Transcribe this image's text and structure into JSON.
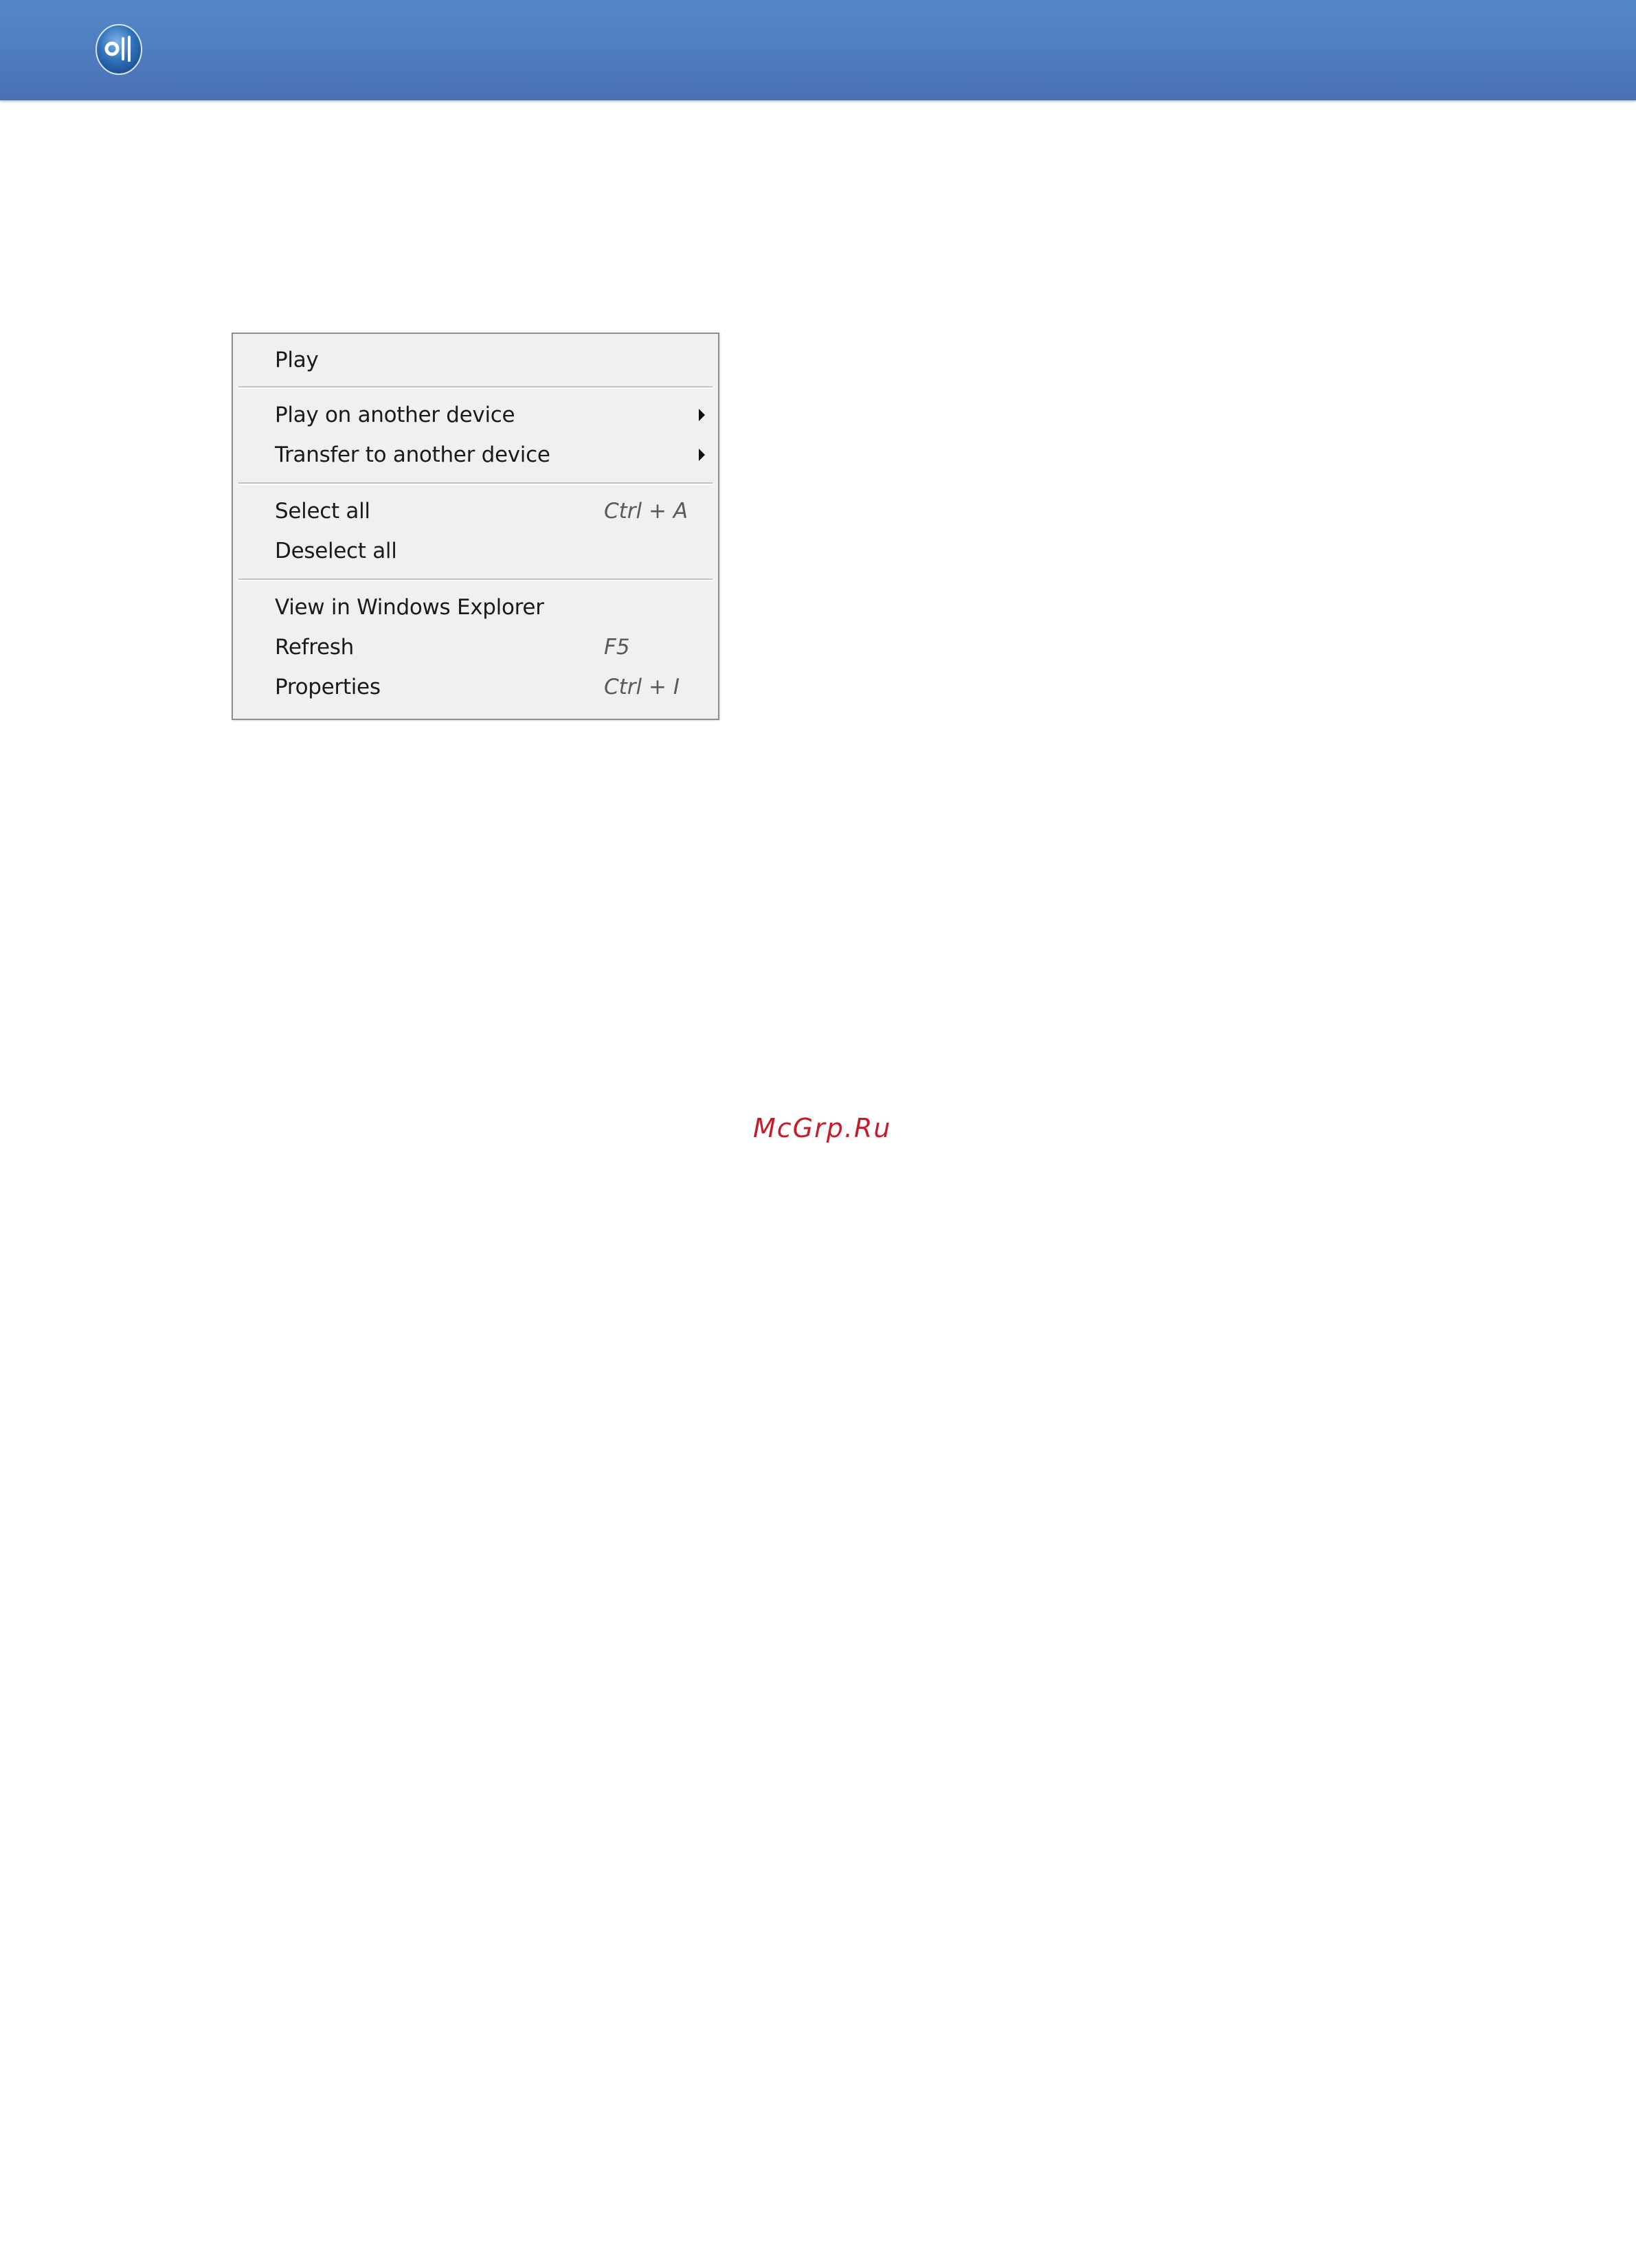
{
  "header": {
    "logo_icon": "app-logo-icon",
    "colors": {
      "banner_top": "#5487c8",
      "banner_bottom": "#4a70b2"
    }
  },
  "context_menu": {
    "items": [
      {
        "label": "Play",
        "shortcut": ""
      },
      {
        "label": "Play on another device",
        "submenu_icon": "chevron-right-icon"
      },
      {
        "label": "Transfer to another device",
        "submenu_icon": "chevron-right-icon"
      },
      {
        "label": "Select all",
        "shortcut": "Ctrl + A"
      },
      {
        "label": "Deselect all",
        "shortcut": ""
      },
      {
        "label": "View in Windows Explorer",
        "shortcut": ""
      },
      {
        "label": "Refresh",
        "shortcut": "F5"
      },
      {
        "label": "Properties",
        "shortcut": "Ctrl + I"
      }
    ]
  },
  "watermark": {
    "text": "McGrp.Ru",
    "color": "#c41e2a"
  }
}
